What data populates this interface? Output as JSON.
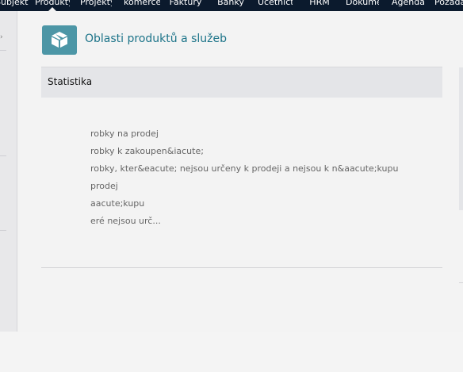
{
  "topnav": {
    "items": [
      {
        "label": "Subjekty"
      },
      {
        "label": "Produkty"
      },
      {
        "label": "Projekty"
      },
      {
        "label": "komerce"
      },
      {
        "label": "Faktury"
      },
      {
        "label": "Banky"
      },
      {
        "label": "Účetnictví"
      },
      {
        "label": "HRM"
      },
      {
        "label": "Dokumenty"
      },
      {
        "label": "Agenda"
      },
      {
        "label": "Požadavky"
      }
    ]
  },
  "header": {
    "title": "Oblasti produktů a služeb",
    "icon": "box-icon",
    "accent_color": "#4c96a6"
  },
  "section": {
    "title": "Statistika"
  },
  "stats": {
    "lines": [
      "robky na prodej",
      "robky k zakoupen&iacute;",
      "robky, kter&eacute; nejsou určeny k prodeji a nejsou k n&aacute;kupu",
      " prodej",
      "aacute;kupu",
      "eré nejsou urč..."
    ]
  }
}
